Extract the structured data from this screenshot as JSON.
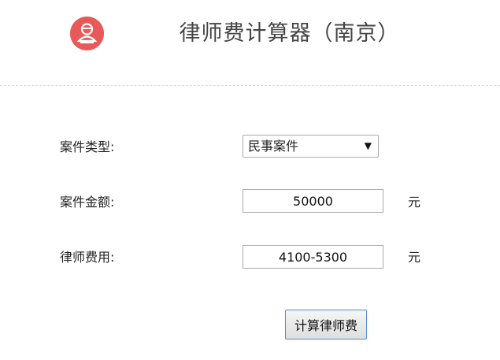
{
  "header": {
    "logo_icon": "lawyer-avatar-icon",
    "logo_color": "#e85a5a",
    "title": "律师费计算器（南京）"
  },
  "form": {
    "case_type": {
      "label": "案件类型:",
      "selected": "民事案件"
    },
    "amount": {
      "label": "案件金额:",
      "value": "50000",
      "unit": "元"
    },
    "fee": {
      "label": "律师费用:",
      "value": "4100-5300",
      "unit": "元"
    },
    "submit_label": "计算律师费",
    "button_border_color": "#4a90d9"
  }
}
